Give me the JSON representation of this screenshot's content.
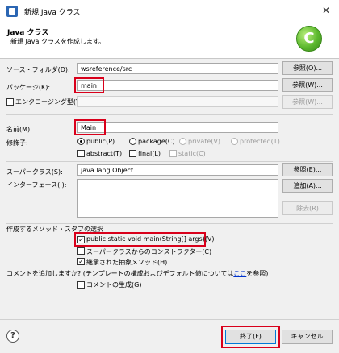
{
  "window": {
    "title": "新規 Java クラス",
    "close_glyph": "✕"
  },
  "banner": {
    "title": "Java クラス",
    "subtitle": "新規 Java クラスを作成します。"
  },
  "source_folder": {
    "label": "ソース・フォルダ(D):",
    "value": "wsreference/src",
    "browse_label": "参照(O)..."
  },
  "package": {
    "label": "パッケージ(K):",
    "value": "main",
    "browse_label": "参照(W)..."
  },
  "enclosing": {
    "label": "エンクロージング型(Y):",
    "value": "",
    "browse_label": "参照(W)..."
  },
  "name": {
    "label": "名前(M):",
    "value": "Main"
  },
  "modifiers": {
    "label": "修飾子:",
    "public": "public(P)",
    "package": "package(C)",
    "private": "private(V)",
    "protected": "protected(T)",
    "abstract": "abstract(T)",
    "final": "final(L)",
    "static": "static(C)"
  },
  "superclass": {
    "label": "スーパークラス(S):",
    "value": "java.lang.Object",
    "browse_label": "参照(E)..."
  },
  "interfaces": {
    "label": "インターフェース(I):",
    "add_label": "追加(A)...",
    "remove_label": "除去(R)"
  },
  "stubs": {
    "label": "作成するメソッド・スタブの選択",
    "main_method": "public static void main(String[] args)(V)",
    "constructors": "スーパークラスからのコンストラクター(C)",
    "inherited": "継承された抽象メソッド(H)"
  },
  "comments": {
    "question_pre": "コメントを追加しますか? (テンプレートの構成およびデフォルト値については",
    "link": "ここ",
    "question_post": "を参照)",
    "generate": "コメントの生成(G)"
  },
  "footer": {
    "finish_label": "終了(F)",
    "cancel_label": "キャンセル"
  },
  "colors": {
    "highlight": "#d9001b",
    "logo": "#5cb82e"
  },
  "icons": {
    "help": "help-icon",
    "logo": "java-class-wizard-icon"
  }
}
